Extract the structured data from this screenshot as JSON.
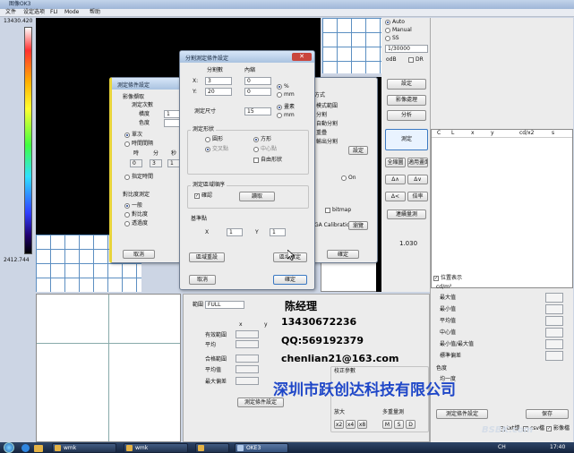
{
  "app": {
    "title": "图像OK3",
    "menu": [
      "文件",
      "设定选项",
      "FLI",
      "Mode",
      "帮助"
    ]
  },
  "colorbar": {
    "max": "13430.420",
    "min": "2412.744"
  },
  "right_panel": {
    "mode_options": [
      "Auto",
      "Manual",
      "SS"
    ],
    "mode_selected": "Auto",
    "exposure_value": "1/30000",
    "odb_label": "odB",
    "dr_label": "DR",
    "buttons": {
      "settings": "設定",
      "image_process": "影像處理",
      "analysis": "分析",
      "measure": "測定",
      "zoom_in": "全縮圖",
      "fit_screen": "適用畫面",
      "up": "Δ∧",
      "down": "Δ∨",
      "left": "Δ<",
      "right": "Δ>",
      "scale": "倍率",
      "stop_measure": "連續量測"
    },
    "value_display": "1.030"
  },
  "data_panel": {
    "columns": [
      "C",
      "L",
      "x",
      "y",
      "cd/x2",
      "s"
    ],
    "show_checkbox": "位置表示",
    "unit": "cd/m²",
    "stats_labels": [
      "最大值",
      "最小值",
      "平均值",
      "中心值",
      "最小值/最大值",
      "標準偏差"
    ],
    "section_label": "色度",
    "subsection": "均一度",
    "spec_button": "測定條件設定",
    "save_button": "保存",
    "bottom_checks": [
      "txt檔",
      "csv檔",
      "影像檔"
    ]
  },
  "bottom_panel": {
    "range_label": "範圍",
    "range_value": "FULL",
    "col_x": "x",
    "col_y": "y",
    "row_labels": [
      "有效範圍",
      "平均",
      "合格範圍",
      "平均值",
      "最大偏差"
    ],
    "set_button": "測定條件設定",
    "calc_group": "校正參數",
    "zoom_label": "放大",
    "zoom_buttons": [
      "x2",
      "x4",
      "x8"
    ],
    "multi_label": "多重量測",
    "multi_buttons": [
      "M",
      "S",
      "D"
    ]
  },
  "dialog_back": {
    "title": "測定條件設定",
    "group_title": "影像擷取",
    "rows": [
      "測定次數",
      "橫度",
      "色度"
    ],
    "values": [
      "1",
      "",
      ""
    ],
    "radio_single": "單次",
    "radio_avg": "時間間隔",
    "time_labels": [
      "時",
      "分",
      "秒"
    ],
    "time_values": [
      "0",
      "3",
      "1"
    ],
    "specify_label": "指定時間",
    "compare_group": "對比度測定",
    "compare_options": [
      "一般",
      "對比度",
      "透過度"
    ],
    "cancel_button": "取消"
  },
  "dialog_mid": {
    "labels": [
      "方式",
      "模式範圍",
      "分割",
      "自動分割",
      "重疊",
      "輸出分割"
    ],
    "bitmap_label": "bitmap",
    "calibration_label": "GA Calibration",
    "browse_button": "瀏覽",
    "confirm_button": "確定",
    "settings_button": "設定",
    "radio_on": "On"
  },
  "dialog_front": {
    "title": "分割測定條件設定",
    "col_count": "分割數",
    "col_inner": "內縮",
    "x_label": "X:",
    "y_label": "Y:",
    "x_count": "3",
    "y_count": "20",
    "x_inner": "0",
    "y_inner": "0",
    "unit_pct": "%",
    "unit_mm": "mm",
    "size_label": "測定尺寸",
    "size_value": "15",
    "size_unit_px": "畫素",
    "size_unit_mm": "mm",
    "shape_group": "測定形狀",
    "shape_circle": "圓形",
    "shape_square": "方形",
    "shape_cross": "交叉點",
    "shape_center": "中心點",
    "shape_free": "自由形狀",
    "order_group": "測定區域順序",
    "order_check": "確認",
    "order_button": "讀取",
    "base_group": "基準點",
    "base_x_label": "X",
    "base_x": "1",
    "base_y_label": "Y",
    "base_y": "1",
    "redraw_button": "區域重設",
    "region_button": "區域確定",
    "cancel_button": "取消",
    "ok_button": "確定"
  },
  "watermark": {
    "name": "陈经理",
    "phone": "13430672236",
    "qq": "QQ:569192379",
    "email": "chenlian21@163.com",
    "company": "深圳市跃创达科技有限公司",
    "site": "BSBK.com"
  },
  "taskbar": {
    "items": [
      "wmk",
      "wmk",
      "",
      "OKE3"
    ],
    "tray": "CH",
    "time": "17:40"
  }
}
